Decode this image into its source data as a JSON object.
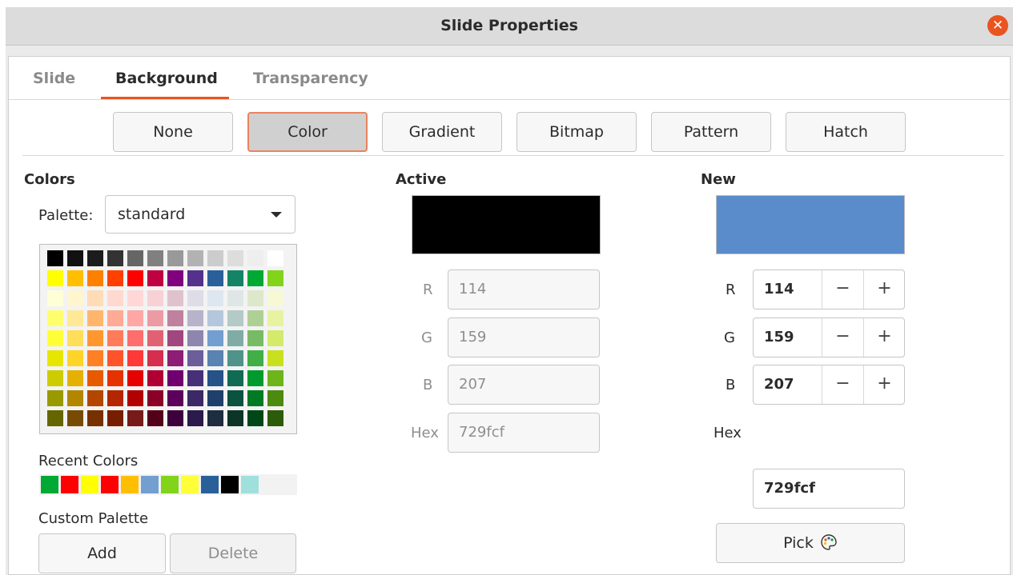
{
  "window": {
    "title": "Slide Properties",
    "close_icon": "close-icon"
  },
  "tabs": [
    {
      "label": "Slide",
      "active": false
    },
    {
      "label": "Background",
      "active": true
    },
    {
      "label": "Transparency",
      "active": false
    }
  ],
  "fill_types": [
    {
      "label": "None",
      "selected": false
    },
    {
      "label": "Color",
      "selected": true
    },
    {
      "label": "Gradient",
      "selected": false
    },
    {
      "label": "Bitmap",
      "selected": false
    },
    {
      "label": "Pattern",
      "selected": false
    },
    {
      "label": "Hatch",
      "selected": false
    }
  ],
  "colors": {
    "heading": "Colors",
    "palette_label": "Palette:",
    "palette_value": "standard",
    "swatches": [
      [
        "#000000",
        "#111111",
        "#1c1c1c",
        "#333333",
        "#666666",
        "#808080",
        "#999999",
        "#b2b2b2",
        "#cccccc",
        "#dddddd",
        "#eeeeee",
        "#ffffff"
      ],
      [
        "#ffff00",
        "#ffbf00",
        "#ff8000",
        "#ff4000",
        "#ff0000",
        "#bf0041",
        "#800080",
        "#55308d",
        "#2a6099",
        "#158466",
        "#00a933",
        "#81d41a"
      ],
      [
        "#ffffd7",
        "#fff5ce",
        "#ffdbb6",
        "#ffd8ce",
        "#ffd7d7",
        "#f7d1d5",
        "#e0c2cd",
        "#dedce6",
        "#dee6ef",
        "#dee7e5",
        "#dde8cb",
        "#f6f9d4"
      ],
      [
        "#ffff6d",
        "#ffe994",
        "#ffb66c",
        "#ffaa95",
        "#ffa6a6",
        "#ec9ba4",
        "#bf819e",
        "#b7b3ca",
        "#b4c7dc",
        "#b3cac7",
        "#afd095",
        "#e8f2a1"
      ],
      [
        "#ffff38",
        "#ffde59",
        "#ff972f",
        "#ff7b59",
        "#ff6d6d",
        "#e16173",
        "#a1467e",
        "#8e86ae",
        "#729fcf",
        "#81aca6",
        "#77bc65",
        "#d4ea6b"
      ],
      [
        "#e6e600",
        "#ffd428",
        "#ff7f24",
        "#ff5429",
        "#ff3838",
        "#d62e4e",
        "#8d1d75",
        "#6b5e9b",
        "#5983b0",
        "#50938a",
        "#3faf46",
        "#c9e01e"
      ],
      [
        "#cccc00",
        "#e6b000",
        "#e65a00",
        "#e63200",
        "#e60000",
        "#b00033",
        "#700070",
        "#483079",
        "#275288",
        "#0f6b53",
        "#009b2c",
        "#6db51a"
      ],
      [
        "#999900",
        "#b38600",
        "#b34700",
        "#b32600",
        "#b30000",
        "#8b0028",
        "#5c005c",
        "#3c2866",
        "#213f6b",
        "#0a5340",
        "#007a23",
        "#4d8a10"
      ],
      [
        "#666600",
        "#784b04",
        "#783000",
        "#781e00",
        "#781a1a",
        "#55001b",
        "#3d003d",
        "#2b1a4c",
        "#1e2d3f",
        "#0c3527",
        "#004717",
        "#2c5c0a"
      ]
    ]
  },
  "recent": {
    "label": "Recent Colors",
    "swatches": [
      "#00a933",
      "#ff0000",
      "#ffff00",
      "#ff0000",
      "#ffbf00",
      "#729fcf",
      "#81d41a",
      "#ffff38",
      "#2a6099",
      "#000000",
      "#9fe0dc",
      "#f2f2f2"
    ]
  },
  "custom_palette": {
    "label": "Custom Palette",
    "add_label": "Add",
    "delete_label": "Delete"
  },
  "active": {
    "heading": "Active",
    "color": "#000000",
    "r_label": "R",
    "r": "114",
    "g_label": "G",
    "g": "159",
    "b_label": "B",
    "b": "207",
    "hex_label": "Hex",
    "hex": "729fcf"
  },
  "new": {
    "heading": "New",
    "color": "#5a8bca",
    "r_label": "R",
    "r": "114",
    "g_label": "G",
    "g": "159",
    "b_label": "B",
    "b": "207",
    "hex_label": "Hex",
    "hex": "729fcf",
    "minus": "−",
    "plus": "+",
    "pick_label": "Pick",
    "pick_icon": "color-palette-icon"
  },
  "accent": "#e95420"
}
